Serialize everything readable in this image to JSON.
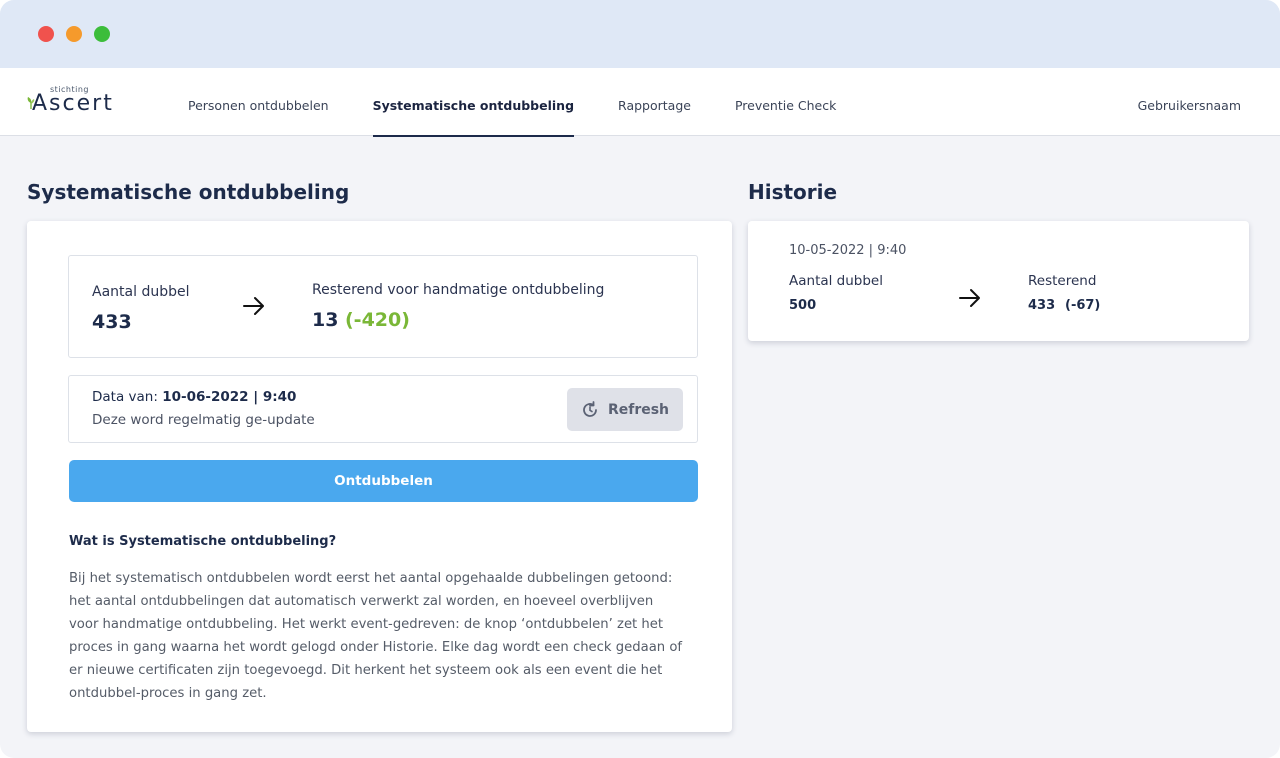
{
  "app": {
    "logo_small": "stichting",
    "logo_main": "Ascert"
  },
  "nav": {
    "items": [
      {
        "label": "Personen ontdubbelen"
      },
      {
        "label": "Systematische ontdubbeling"
      },
      {
        "label": "Rapportage"
      },
      {
        "label": "Preventie Check"
      }
    ],
    "active_index": 1,
    "user": "Gebruikersnaam"
  },
  "main": {
    "title": "Systematische ontdubbeling",
    "stats": {
      "aantal_label": "Aantal dubbel",
      "aantal_value": "433",
      "resterend_label": "Resterend voor handmatige ontdubbeling",
      "resterend_value": "13",
      "resterend_delta": "(-420)"
    },
    "data_info": {
      "prefix": "Data van: ",
      "date": "10-06-2022 | 9:40",
      "note": "Deze word regelmatig ge-update",
      "refresh_label": "Refresh"
    },
    "primary_button": "Ontdubbelen",
    "faq": {
      "title": "Wat is Systematische ontdubbeling?",
      "body": "Bij het systematisch ontdubbelen wordt eerst het aantal opgehaalde dubbelingen getoond: het aantal ontdubbelingen dat automatisch verwerkt zal worden, en hoeveel overblijven voor handmatige ontdubbeling. Het werkt event-gedreven: de knop ‘ontdubbelen’ zet het proces in gang waarna het wordt gelogd onder Historie. Elke dag wordt een check gedaan of er nieuwe certificaten zijn toegevoegd. Dit herkent het systeem ook als een event die het ontdubbel-proces in gang zet."
    }
  },
  "history": {
    "title": "Historie",
    "entry": {
      "date": "10-05-2022 | 9:40",
      "aantal_label": "Aantal dubbel",
      "aantal_value": "500",
      "resterend_label": "Resterend",
      "resterend_value": "433",
      "resterend_delta": "(-67)"
    }
  },
  "colors": {
    "accent": "#4aa8ee",
    "positive": "#7ab737",
    "brand": "#1d2b4a"
  }
}
